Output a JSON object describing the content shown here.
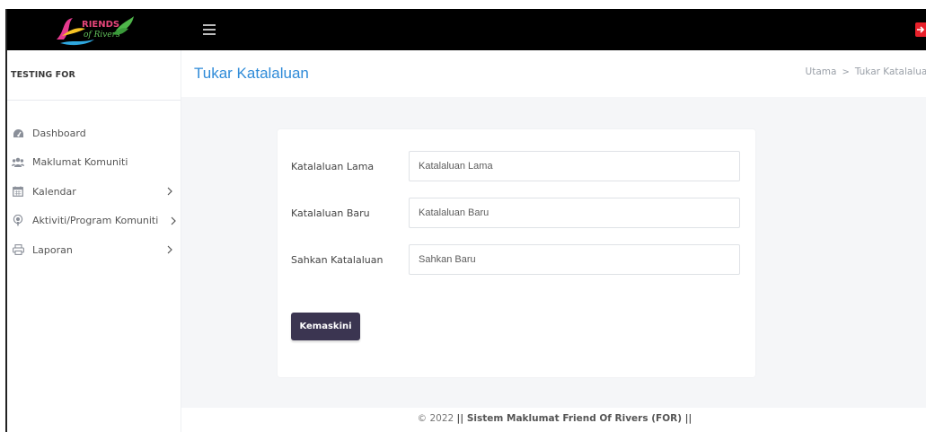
{
  "topbar": {
    "logo_text": "FRIENDS of Rivers"
  },
  "sidebar": {
    "brand": "TESTING FOR",
    "items": [
      {
        "label": "Dashboard",
        "icon": "dashboard-icon",
        "has_chevron": false
      },
      {
        "label": "Maklumat Komuniti",
        "icon": "users-icon",
        "has_chevron": false
      },
      {
        "label": "Kalendar",
        "icon": "calendar-icon",
        "has_chevron": true
      },
      {
        "label": "Aktiviti/Program Komuniti",
        "icon": "podcast-icon",
        "has_chevron": true
      },
      {
        "label": "Laporan",
        "icon": "print-icon",
        "has_chevron": true
      }
    ]
  },
  "header": {
    "title": "Tukar Katalaluan",
    "breadcrumb": [
      "Utama",
      "Tukar Katalaluan"
    ]
  },
  "form": {
    "fields": [
      {
        "label": "Katalaluan Lama",
        "placeholder": "Katalaluan Lama",
        "value": ""
      },
      {
        "label": "Katalaluan Baru",
        "placeholder": "Katalaluan Baru",
        "value": ""
      },
      {
        "label": "Sahkan Katalaluan",
        "placeholder": "Sahkan Baru",
        "value": ""
      }
    ],
    "submit_label": "Kemaskini"
  },
  "footer": {
    "prefix": "© 2022",
    "text": "|| Sistem Maklumat Friend Of Rivers (FOR) ||"
  },
  "colors": {
    "topbar": "#000000",
    "title": "#2f8bd8",
    "button": "#3b3551",
    "logout": "#e8202a",
    "content_bg": "#f5f6f8"
  }
}
